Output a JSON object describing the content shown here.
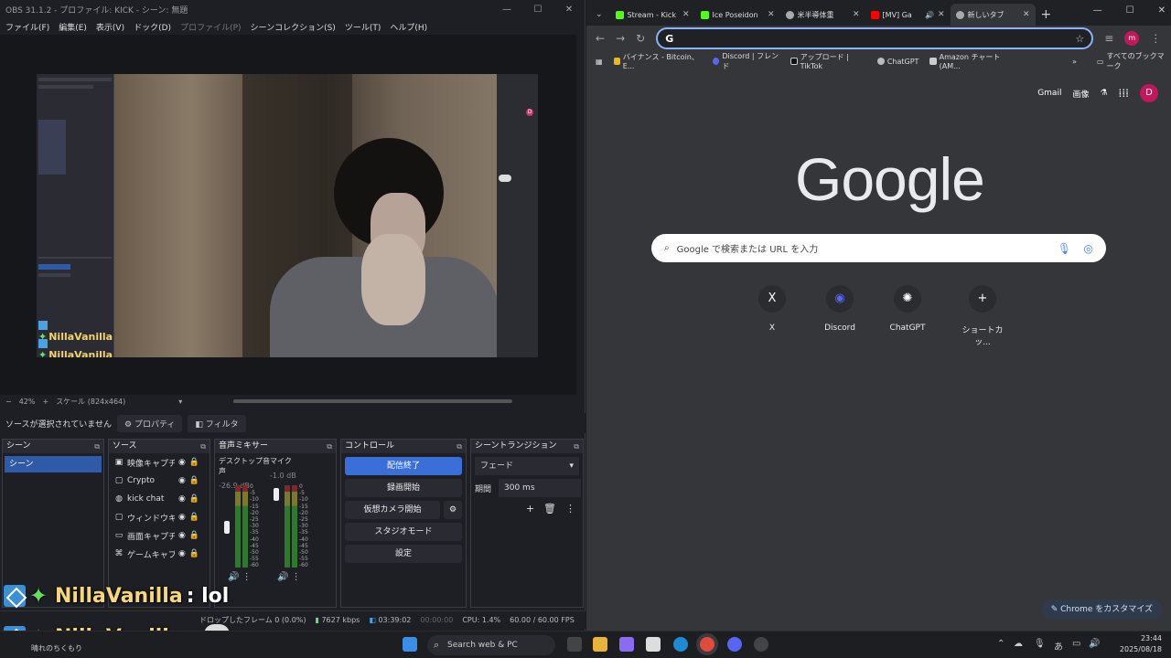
{
  "obs": {
    "title": "OBS 31.1.2 - プロファイル: KICK - シーン: 無題",
    "menu": [
      "ファイル(F)",
      "編集(E)",
      "表示(V)",
      "ドック(D)",
      "プロファイル(P)",
      "シーンコレクション(S)",
      "ツール(T)",
      "ヘルプ(H)"
    ],
    "zoom": "42%",
    "scale": "スケール (824x464)",
    "no_source": "ソースが選択されていません",
    "properties": "プロパティ",
    "filters": "フィルタ",
    "docks": {
      "scenes": "シーン",
      "sources": "ソース",
      "mixer": "音声ミキサー",
      "controls": "コントロール",
      "transitions": "シーントランジション"
    },
    "scene_item": "シーン",
    "sources": [
      {
        "name": "映像キャプチャデバイス",
        "icon": "camera-icon"
      },
      {
        "name": "Crypto",
        "icon": "window-icon"
      },
      {
        "name": "kick chat",
        "icon": "globe-icon"
      },
      {
        "name": "ウィンドウキャプチャ",
        "icon": "window-icon"
      },
      {
        "name": "画面キャプチャ",
        "icon": "monitor-icon"
      },
      {
        "name": "ゲームキャプチャ",
        "icon": "gamepad-icon"
      }
    ],
    "mixer": [
      {
        "name": "デスクトップ音声",
        "db": "-26.9 dB",
        "level": 0.55
      },
      {
        "name": "マイク",
        "db": "-1.0 dB",
        "level": 0.95
      }
    ],
    "scale_labels": [
      "0",
      "-5",
      "-10",
      "-15",
      "-20",
      "-25",
      "-30",
      "-35",
      "-40",
      "-45",
      "-50",
      "-55",
      "-60"
    ],
    "controls": {
      "stop_stream": "配信終了",
      "start_rec": "録画開始",
      "virtual_cam": "仮想カメラ開始",
      "studio": "スタジオモード",
      "settings": "設定"
    },
    "transition": {
      "type": "フェード",
      "duration_label": "期間",
      "duration": "300 ms"
    },
    "status": {
      "dropped": "ドロップしたフレーム 0 (0.0%)",
      "bitrate": "7627 kbps",
      "live_time": "03:39:02",
      "rec_time": "00:00:00",
      "cpu": "CPU: 1.4%",
      "fps": "60.00 / 60.00 FPS"
    },
    "nested_name": "NillaVanilla"
  },
  "chat": [
    {
      "user": "NillaVanilla",
      "msg": " : lol"
    },
    {
      "user": "NillaVanilla",
      "msg": " : "
    }
  ],
  "chat_sub": "晴れのちくもり",
  "chrome": {
    "tabs": [
      {
        "title": "Stream - Kick",
        "color": "#53fc18"
      },
      {
        "title": "Ice Poseidon",
        "color": "#53fc18"
      },
      {
        "title": "米半導体重",
        "color": "#aaaaaa"
      },
      {
        "title": "[MV] Ga",
        "color": "#ff0000"
      },
      {
        "title": "新しいタブ",
        "color": "#aaaaaa"
      }
    ],
    "bookmarks": [
      "バイナンス - Bitcoin、E...",
      "Discord | フレンド",
      "アップロード | TikTok",
      "ChatGPT",
      "Amazon チャート (AM..."
    ],
    "all_bookmarks": "すべてのブックマーク",
    "gmail": "Gmail",
    "images": "画像",
    "avatar": "D",
    "profile": "m",
    "logo": "Google",
    "search_placeholder": "Google で検索または URL を入力",
    "shortcuts": [
      {
        "label": "X",
        "glyph": "X"
      },
      {
        "label": "Discord",
        "glyph": "◉"
      },
      {
        "label": "ChatGPT",
        "glyph": "✺"
      },
      {
        "label": "ショートカッ...",
        "glyph": "+"
      }
    ],
    "customize": "Chrome をカスタマイズ"
  },
  "taskbar": {
    "search": "Search web & PC",
    "time": "23:44",
    "date": "2025/08/18",
    "ime": "あ"
  }
}
